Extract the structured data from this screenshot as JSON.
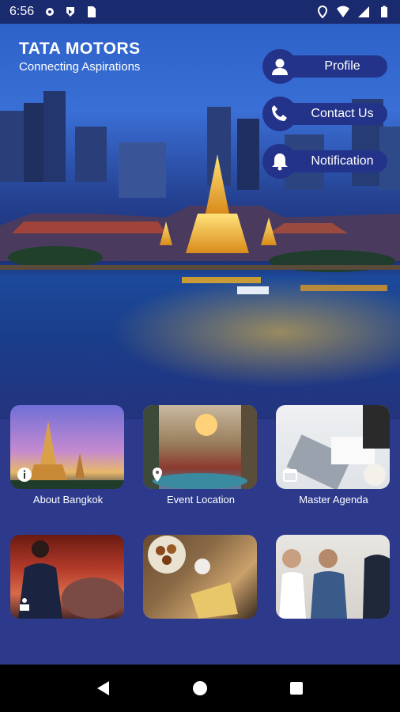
{
  "status_bar": {
    "time": "6:56"
  },
  "brand": {
    "name": "TATA MOTORS",
    "tagline": "Connecting Aspirations"
  },
  "menu": [
    {
      "label": "Profile",
      "icon": "person-icon"
    },
    {
      "label": "Contact Us",
      "icon": "phone-icon"
    },
    {
      "label": "Notification",
      "icon": "bell-icon"
    }
  ],
  "tiles": [
    {
      "label": "About Bangkok",
      "icon": "info-icon"
    },
    {
      "label": "Event Location",
      "icon": "location-pin-icon"
    },
    {
      "label": "Master Agenda",
      "icon": "calendar-icon"
    },
    {
      "label": "",
      "icon": "speaker-icon"
    },
    {
      "label": "",
      "icon": ""
    },
    {
      "label": "",
      "icon": ""
    }
  ],
  "colors": {
    "primary": "#23338a",
    "background": "#2d3a8c",
    "status_bar": "#1a2a6e"
  }
}
